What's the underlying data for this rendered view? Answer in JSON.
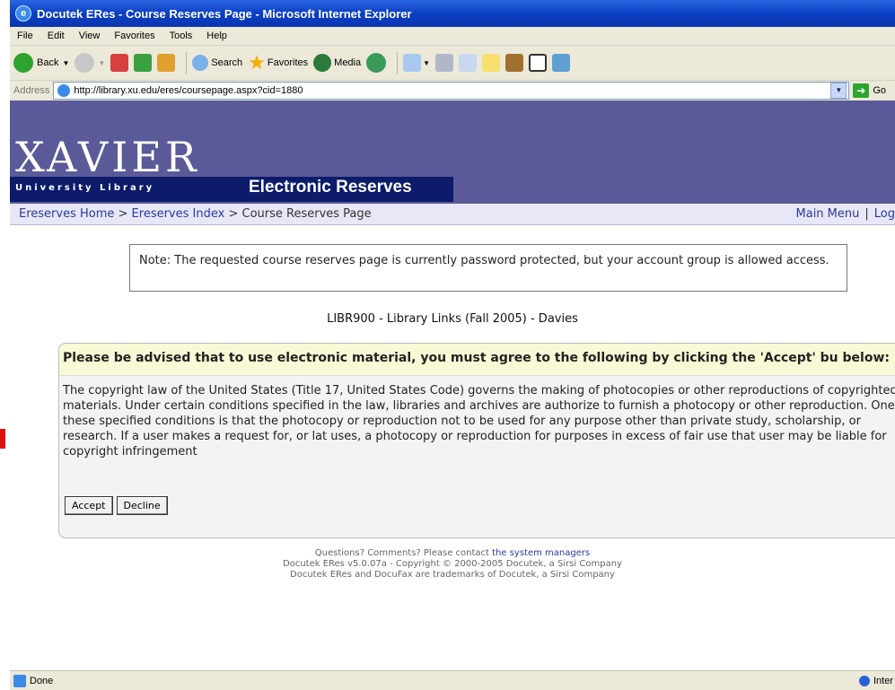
{
  "window": {
    "title": "Docutek ERes - Course Reserves Page - Microsoft Internet Explorer"
  },
  "menu": [
    "File",
    "Edit",
    "View",
    "Favorites",
    "Tools",
    "Help"
  ],
  "toolbar": {
    "back": "Back",
    "search": "Search",
    "favorites": "Favorites",
    "media": "Media"
  },
  "address": {
    "label": "Address",
    "url": "http://library.xu.edu/eres/coursepage.aspx?cid=1880",
    "go": "Go"
  },
  "banner": {
    "logo": "XAVIER",
    "sublogo": "University Library",
    "section": "Electronic Reserves"
  },
  "breadcrumb": {
    "home": "Ereserves Home",
    "sep1": " > ",
    "index": "Ereserves Index",
    "sep2": " > ",
    "current": "Course Reserves Page",
    "main_menu": "Main Menu",
    "divider": "|",
    "logout": "Log"
  },
  "note": "Note: The requested course reserves page is currently password protected, but your account group is allowed access.",
  "course_title": "LIBR900 - Library Links (Fall 2005) - Davies",
  "agreement": {
    "heading": "Please be advised that to use electronic material, you must agree to the following by clicking the 'Accept' bu below:",
    "body": "The copyright law of the United States (Title 17, United States Code) governs the making of photocopies or other reproductions of copyrighted materials. Under certain conditions specified in the law, libraries and archives are authorize to furnish a photocopy or other reproduction. One of these specified conditions is that the photocopy or reproduction not to be used for any purpose other than private study, scholarship, or research. If a user makes a request for, or lat uses, a photocopy or reproduction for purposes in excess of fair use that user may be liable for copyright infringement",
    "accept": "Accept",
    "decline": "Decline"
  },
  "footer": {
    "line1_prefix": "Questions? Comments? Please contact ",
    "line1_link": "the system managers",
    "line2": "Docutek ERes v5.0.07a - Copyright © 2000-2005 Docutek, a Sirsi Company",
    "line3": "Docutek ERes and DocuFax are trademarks of Docutek, a Sirsi Company"
  },
  "status": {
    "left": "Done",
    "right": "Inter"
  }
}
